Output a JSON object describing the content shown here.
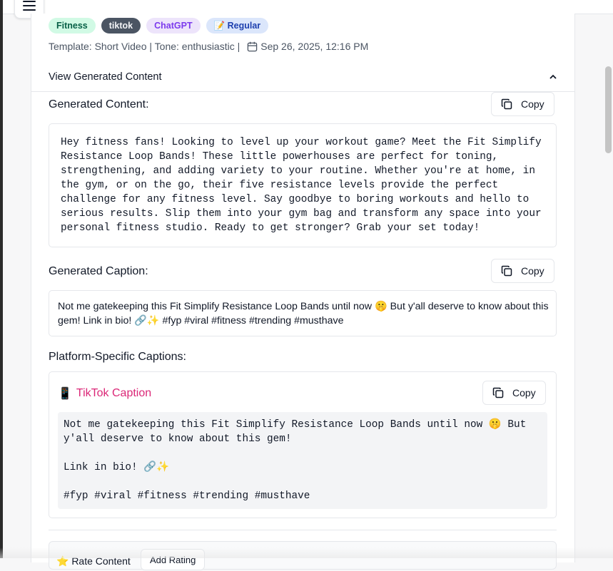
{
  "tags": [
    "Fitness",
    "tiktok",
    "ChatGPT",
    "📝 Regular"
  ],
  "meta": {
    "template_tone": "Template: Short Video | Tone: enthusiastic |",
    "date": "Sep 26, 2025, 12:16 PM"
  },
  "view_toggle": {
    "label": "View Generated Content"
  },
  "generated_content": {
    "title": "Generated Content:",
    "copy_label": "Copy",
    "text": "Hey fitness fans! Looking to level up your workout game? Meet the Fit Simplify Resistance Loop Bands! These little powerhouses are perfect for toning, strengthening, and adding variety to your routine. Whether you're at home, in the gym, or on the go, their five resistance levels provide the perfect challenge for any fitness level. Say goodbye to boring workouts and hello to serious results. Slip them into your gym bag and transform any space into your personal fitness studio. Ready to get stronger? Grab your set today!"
  },
  "generated_caption": {
    "title": "Generated Caption:",
    "copy_label": "Copy",
    "text": "Not me gatekeeping this Fit Simplify Resistance Loop Bands until now 🤫 But y'all deserve to know about this gem! Link in bio! 🔗✨ #fyp #viral #fitness #trending #musthave"
  },
  "platform_captions": {
    "title": "Platform-Specific Captions:",
    "tiktok": {
      "emoji": "📱",
      "title": "TikTok Caption",
      "copy_label": "Copy",
      "text": "Not me gatekeeping this Fit Simplify Resistance Loop Bands until now 🤫 But\ny'all deserve to know about this gem!\n\nLink in bio! 🔗✨\n\n#fyp #viral #fitness #trending #musthave"
    }
  },
  "rating": {
    "label": "⭐ Rate Content",
    "add_label": "Add Rating"
  }
}
